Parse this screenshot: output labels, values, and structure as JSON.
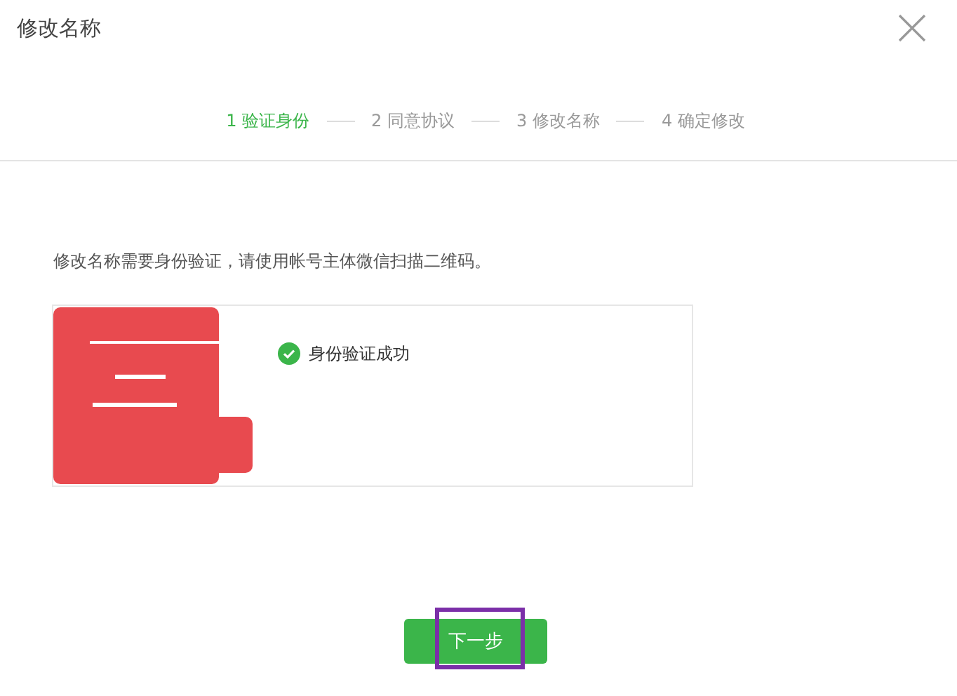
{
  "dialog": {
    "title": "修改名称"
  },
  "steps": [
    {
      "label": "1 验证身份",
      "selected": true
    },
    {
      "label": "2 同意协议",
      "selected": false
    },
    {
      "label": "3 修改名称",
      "selected": false
    },
    {
      "label": "4 确定修改",
      "selected": false
    }
  ],
  "instruction": "修改名称需要身份验证，请使用帐号主体微信扫描二维码。",
  "verification": {
    "status": "身份验证成功",
    "success": true
  },
  "next_button": {
    "label": "下一步",
    "highlighted": true
  }
}
